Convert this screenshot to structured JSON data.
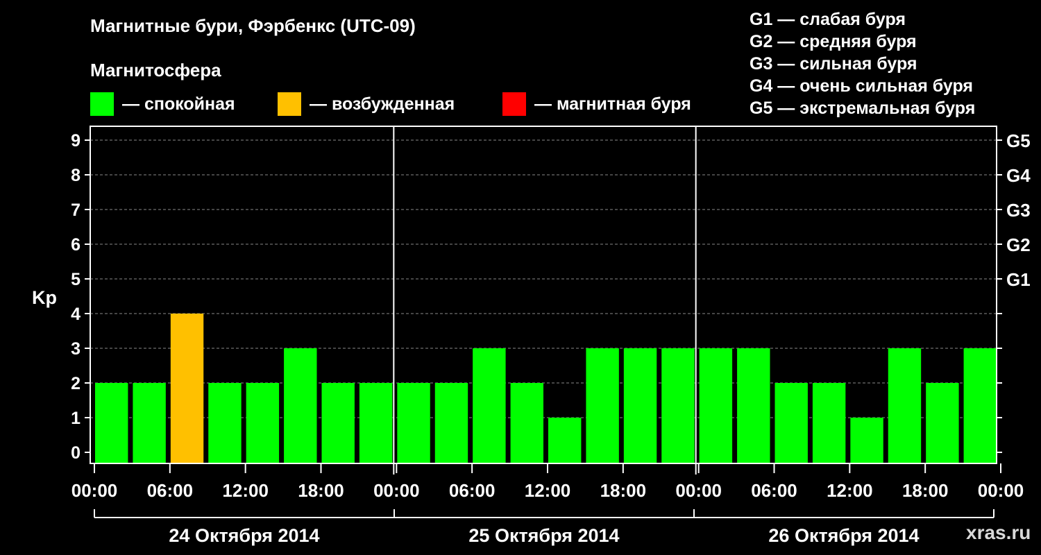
{
  "header": {
    "title": "Магнитные бури, Фэрбенкс (UTC-09)",
    "magnetosphere_label": "Магнитосфера"
  },
  "legend": [
    {
      "label": "— спокойная",
      "color": "#00ff00"
    },
    {
      "label": "— возбужденная",
      "color": "#ffc000"
    },
    {
      "label": "— магнитная буря",
      "color": "#ff0000"
    }
  ],
  "storm_levels": [
    "G1 — слабая буря",
    "G2 — средняя буря",
    "G3 — сильная буря",
    "G4 — очень сильная буря",
    "G5 — экстремальная буря"
  ],
  "watermark": "xras.ru",
  "chart_data": {
    "type": "bar",
    "ylabel": "Kp",
    "ylim": [
      0,
      9
    ],
    "y_ticks": [
      "0",
      "1",
      "2",
      "3",
      "4",
      "5",
      "6",
      "7",
      "8",
      "9"
    ],
    "right_axis_labels": [
      {
        "value": 5,
        "label": "G1"
      },
      {
        "value": 6,
        "label": "G2"
      },
      {
        "value": 7,
        "label": "G3"
      },
      {
        "value": 8,
        "label": "G4"
      },
      {
        "value": 9,
        "label": "G5"
      }
    ],
    "x_ticks": [
      "00:00",
      "06:00",
      "12:00",
      "18:00",
      "00:00",
      "06:00",
      "12:00",
      "18:00",
      "00:00",
      "06:00",
      "12:00",
      "18:00",
      "00:00"
    ],
    "days": [
      "24 Октября 2014",
      "25 Октября 2014",
      "26 Октября 2014"
    ],
    "values": [
      2,
      2,
      4,
      2,
      2,
      3,
      2,
      2,
      2,
      2,
      3,
      2,
      1,
      3,
      3,
      3,
      3,
      3,
      2,
      2,
      1,
      3,
      2,
      3
    ],
    "colors": {
      "quiet": "#00ff00",
      "active": "#ffc000",
      "storm": "#ff0000"
    },
    "grid": true
  }
}
